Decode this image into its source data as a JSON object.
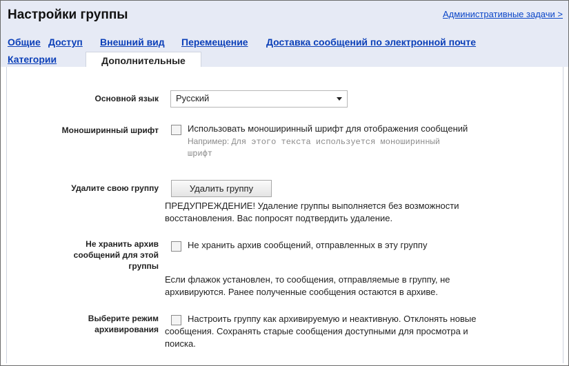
{
  "header": {
    "title": "Настройки группы",
    "admin_link": "Административные задачи >"
  },
  "tabs": [
    {
      "label": "Общие"
    },
    {
      "label": "Доступ"
    },
    {
      "label": "Внешний вид"
    },
    {
      "label": "Перемещение"
    },
    {
      "label": "Доставка сообщений по электронной почте"
    },
    {
      "label": "Категории"
    },
    {
      "label": "Дополнительные",
      "active": true
    }
  ],
  "settings": {
    "language": {
      "label": "Основной язык",
      "value": "Русский"
    },
    "monospace": {
      "label": "Моноширинный шрифт",
      "checkbox_label": "Использовать моноширинный шрифт для отображения сообщений",
      "example_prefix": "Например:",
      "example_line1": "Для этого текста используется моноширинный",
      "example_line2": "шрифт",
      "checked": false
    },
    "delete_group": {
      "label": "Удалите свою группу",
      "button": "Удалить группу",
      "warning_line1": "ПРЕДУПРЕЖДЕНИЕ! Удаление группы выполняется без возможности",
      "warning_line2": "восстановления. Вас попросят подтвердить удаление."
    },
    "no_archive": {
      "label_line1": "Не хранить архив",
      "label_line2": "сообщений для этой",
      "label_line3": "группы",
      "checkbox_label": "Не хранить архив сообщений, отправленных в эту группу",
      "checked": false,
      "note_line1": "Если флажок установлен, то сообщения, отправляемые в группу, не",
      "note_line2": "архивируются. Ранее полученные сообщения остаются в архиве."
    },
    "archive_mode": {
      "label_line1": "Выберите режим",
      "label_line2": "архивирования",
      "checkbox_label_line1": "Настроить группу как архивируемую и неактивную. Отклонять новые",
      "line2": "сообщения. Сохранять старые сообщения доступными для просмотра и",
      "line3": "поиска.",
      "checked": false
    }
  },
  "colors": {
    "header_bg": "#e6eaf5",
    "link": "#0b3fb8",
    "border": "#6b6b6b"
  },
  "icons": {
    "dropdown": "chevron-down-icon"
  }
}
